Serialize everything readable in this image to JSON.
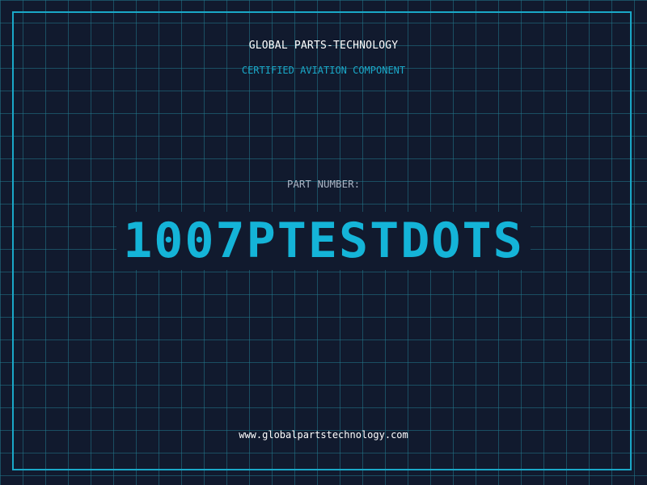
{
  "header": {
    "company": "GLOBAL PARTS-TECHNOLOGY",
    "tagline": "CERTIFIED AVIATION COMPONENT"
  },
  "part": {
    "label": "PART NUMBER:",
    "number": "1007PTESTDOTS"
  },
  "footer": {
    "url": "www.globalpartstechnology.com"
  },
  "colors": {
    "background": "#111a2e",
    "grid": "#22788c",
    "accent": "#14b4d8",
    "text": "#ffffff",
    "muted": "#aab4c4"
  }
}
